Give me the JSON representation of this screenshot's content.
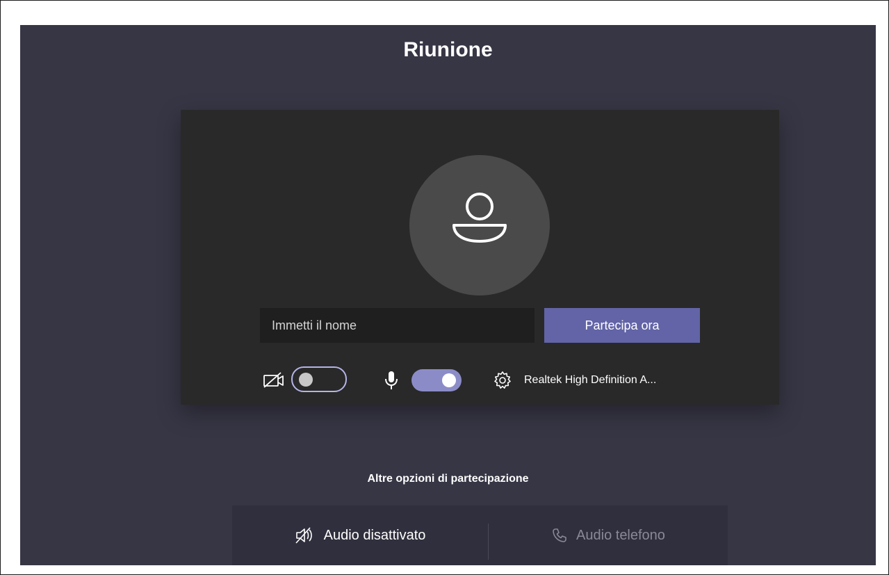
{
  "meeting": {
    "title": "Riunione"
  },
  "join": {
    "name_placeholder": "Immetti il nome",
    "name_value": "",
    "join_label": "Partecipa ora"
  },
  "devices": {
    "camera_on": false,
    "mic_on": true,
    "audio_device": "Realtek High Definition A..."
  },
  "more_options": {
    "title": "Altre opzioni di partecipazione",
    "audio_off_label": "Audio disattivato",
    "phone_audio_label": "Audio telefono"
  },
  "colors": {
    "background": "#373645",
    "preview": "#292929",
    "accent": "#6264a7",
    "toggle_on": "#8b8cc7",
    "toggle_off_border": "#b4b5e8"
  },
  "icons": [
    "person-icon",
    "camera-off-icon",
    "microphone-icon",
    "gear-icon",
    "speaker-off-icon",
    "phone-icon"
  ]
}
